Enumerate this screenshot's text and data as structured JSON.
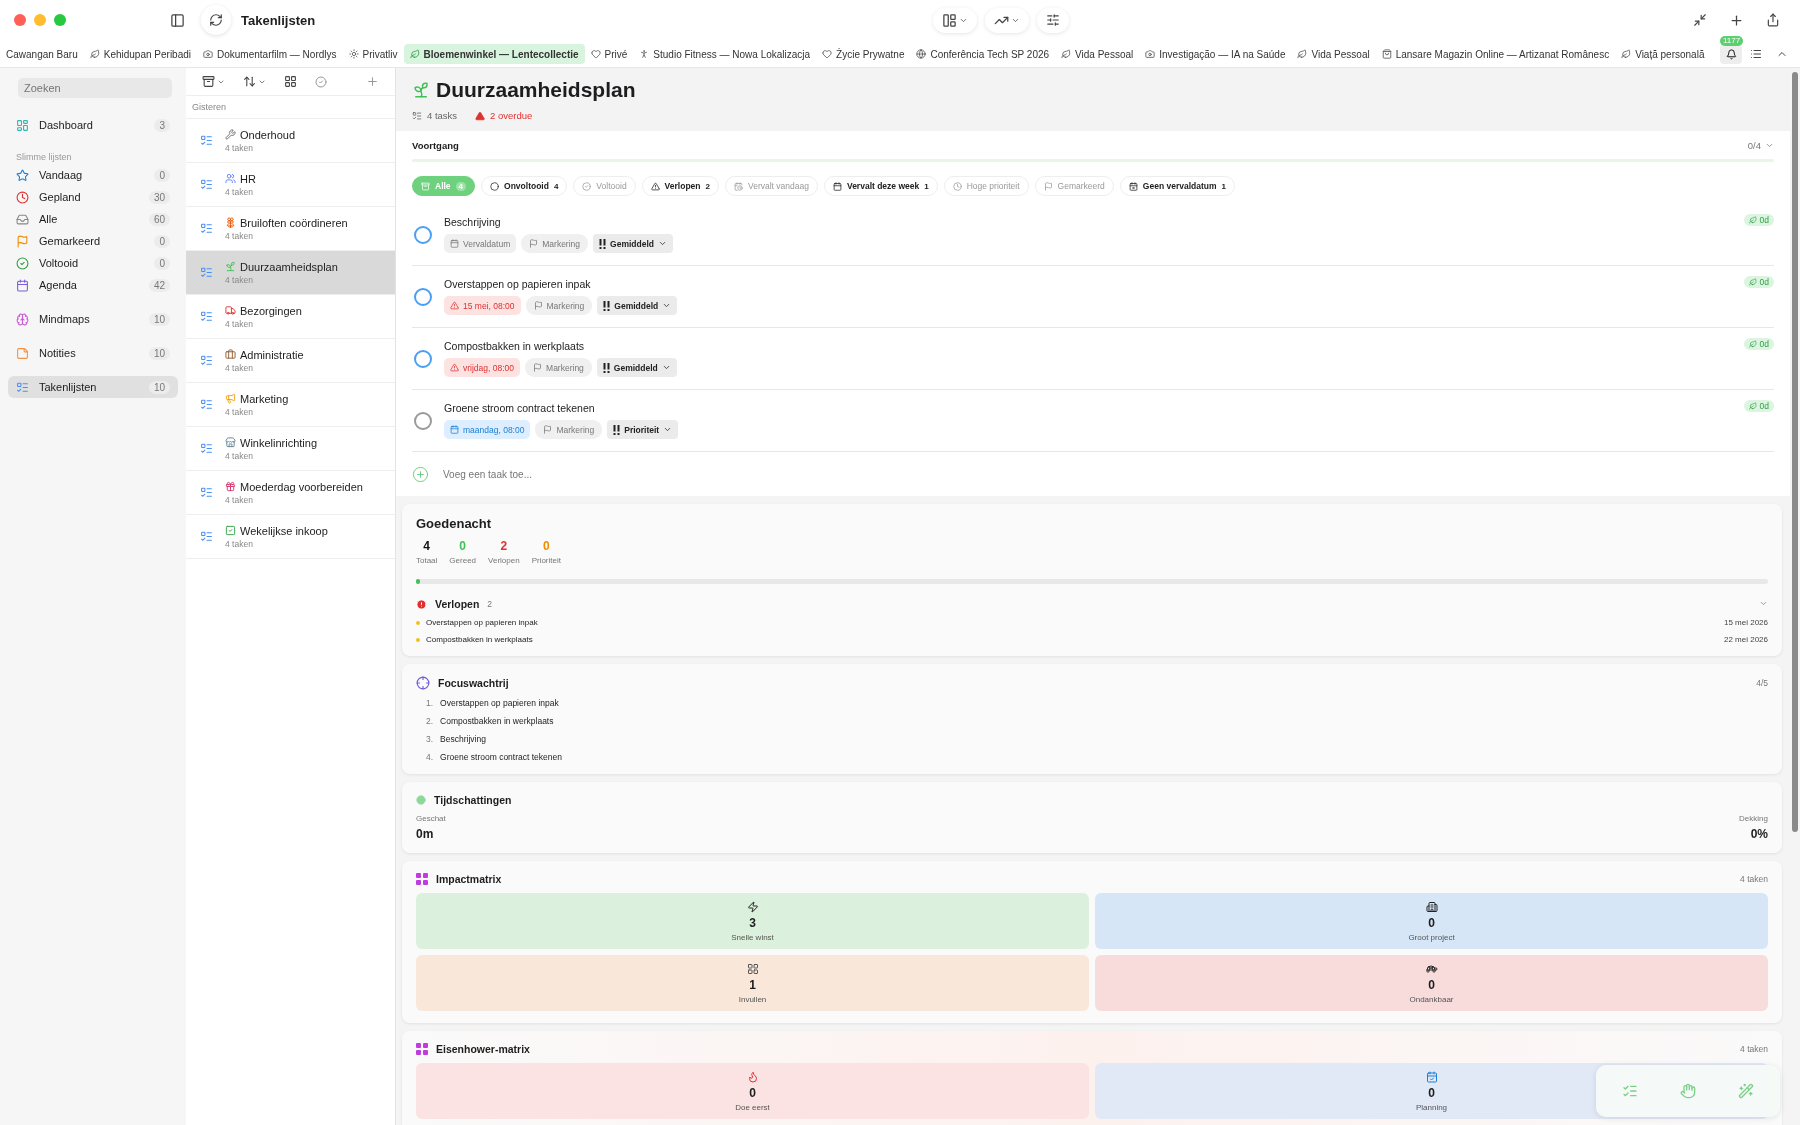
{
  "window": {
    "title": "Takenlijsten"
  },
  "tabs": [
    {
      "label": "Cawangan Baru",
      "selected": false
    },
    {
      "label": "Kehidupan Peribadi",
      "selected": false
    },
    {
      "label": "Dokumentarfilm — Nordlys",
      "selected": false
    },
    {
      "label": "Privatliv",
      "selected": false
    },
    {
      "label": "Bloemenwinkel — Lentecollectie",
      "selected": true
    },
    {
      "label": "Privé",
      "selected": false
    },
    {
      "label": "Studio Fitness — Nowa Lokalizacja",
      "selected": false
    },
    {
      "label": "Życie Prywatne",
      "selected": false
    },
    {
      "label": "Conferência Tech SP 2026",
      "selected": false
    },
    {
      "label": "Vida Pessoal",
      "selected": false
    },
    {
      "label": "Investigação — IA na Saúde",
      "selected": false
    },
    {
      "label": "Vida Pessoal",
      "selected": false
    },
    {
      "label": "Lansare Magazin Online — Artizanat Românesc",
      "selected": false
    },
    {
      "label": "Viață personală",
      "selected": false
    }
  ],
  "notifications": {
    "count": "1177"
  },
  "sidebar": {
    "search": {
      "placeholder": "Zoeken"
    },
    "groups": [
      {
        "items": [
          {
            "label": "Dashboard",
            "count": "3",
            "selected": false
          }
        ]
      },
      {
        "title": "Slimme lijsten",
        "items": [
          {
            "label": "Vandaag",
            "count": "0",
            "selected": false
          },
          {
            "label": "Gepland",
            "count": "30",
            "selected": false
          },
          {
            "label": "Alle",
            "count": "60",
            "selected": false
          },
          {
            "label": "Gemarkeerd",
            "count": "0",
            "selected": false
          },
          {
            "label": "Voltooid",
            "count": "0",
            "selected": false
          },
          {
            "label": "Agenda",
            "count": "42",
            "selected": false
          }
        ]
      },
      {
        "items": [
          {
            "label": "Mindmaps",
            "count": "10",
            "selected": false
          }
        ]
      },
      {
        "items": [
          {
            "label": "Notities",
            "count": "10",
            "selected": false
          }
        ]
      },
      {
        "items": [
          {
            "label": "Takenlijsten",
            "count": "10",
            "selected": true
          }
        ]
      }
    ]
  },
  "lists": {
    "section": "Gisteren",
    "items": [
      {
        "title": "Onderhoud",
        "subtitle": "4 taken",
        "selected": false
      },
      {
        "title": "HR",
        "subtitle": "4 taken",
        "selected": false
      },
      {
        "title": "Bruiloften coördineren",
        "subtitle": "4 taken",
        "selected": false
      },
      {
        "title": "Duurzaamheidsplan",
        "subtitle": "4 taken",
        "selected": true
      },
      {
        "title": "Bezorgingen",
        "subtitle": "4 taken",
        "selected": false
      },
      {
        "title": "Administratie",
        "subtitle": "4 taken",
        "selected": false
      },
      {
        "title": "Marketing",
        "subtitle": "4 taken",
        "selected": false
      },
      {
        "title": "Winkelinrichting",
        "subtitle": "4 taken",
        "selected": false
      },
      {
        "title": "Moederdag voorbereiden",
        "subtitle": "4 taken",
        "selected": false
      },
      {
        "title": "Wekelijkse inkoop",
        "subtitle": "4 taken",
        "selected": false
      }
    ]
  },
  "header": {
    "title": "Duurzaamheidsplan",
    "tasks": "4 tasks",
    "overdue": "2 overdue"
  },
  "progress": {
    "label": "Voortgang",
    "reading": "0/4",
    "level": 0
  },
  "filters": [
    {
      "label": "Alle",
      "count": "4",
      "selected": true,
      "disabled": false
    },
    {
      "label": "Onvoltooid",
      "count": "4",
      "selected": false,
      "disabled": false
    },
    {
      "label": "Voltooid",
      "selected": false,
      "disabled": true
    },
    {
      "label": "Verlopen",
      "count": "2",
      "selected": false,
      "disabled": false
    },
    {
      "label": "Vervalt vandaag",
      "selected": false,
      "disabled": true
    },
    {
      "label": "Vervalt deze week",
      "count": "1",
      "selected": false,
      "disabled": false
    },
    {
      "label": "Hoge prioriteit",
      "selected": false,
      "disabled": true
    },
    {
      "label": "Gemarkeerd",
      "selected": false,
      "disabled": true
    },
    {
      "label": "Geen vervaldatum",
      "count": "1",
      "selected": false,
      "disabled": false
    }
  ],
  "tasks": [
    {
      "title": "Beschrijving",
      "color": "#4a9ff5",
      "due": {
        "kind": "empty",
        "text": "Vervaldatum"
      },
      "flag": "Markering",
      "priority": "Gemiddeld",
      "age": "0d"
    },
    {
      "title": "Overstappen op papieren inpak",
      "color": "#4a9ff5",
      "due": {
        "kind": "overdue",
        "text": "15 mei, 08:00"
      },
      "flag": "Markering",
      "priority": "Gemiddeld",
      "age": "0d"
    },
    {
      "title": "Compostbakken in werkplaats",
      "color": "#4a9ff5",
      "due": {
        "kind": "overdue",
        "text": "vrijdag, 08:00"
      },
      "flag": "Markering",
      "priority": "Gemiddeld",
      "age": "0d"
    },
    {
      "title": "Groene stroom contract tekenen",
      "color": "#9a9a9a",
      "due": {
        "kind": "scheduled",
        "text": "maandag, 08:00"
      },
      "flag": "Markering",
      "priority": "Prioriteit",
      "age": "0d"
    }
  ],
  "add_task": {
    "placeholder": "Voeg een taak toe..."
  },
  "summary": {
    "title": "Goedenacht",
    "stats": [
      {
        "value": "4",
        "label": "Totaal",
        "kind": "total"
      },
      {
        "value": "0",
        "label": "Gereed",
        "kind": "done"
      },
      {
        "value": "2",
        "label": "Verlopen",
        "kind": "overdue"
      },
      {
        "value": "0",
        "label": "Prioriteit",
        "kind": "priority"
      }
    ],
    "level": 0,
    "overdue": {
      "title": "Verlopen",
      "count": "2",
      "items": [
        {
          "title": "Overstappen op papieren inpak",
          "date": "15 mei 2026"
        },
        {
          "title": "Compostbakken in werkplaats",
          "date": "22 mei 2026"
        }
      ]
    }
  },
  "focus": {
    "title": "Focuswachtrij",
    "reading": "4/5",
    "items": [
      {
        "number": "1.",
        "title": "Overstappen op papieren inpak"
      },
      {
        "number": "2.",
        "title": "Compostbakken in werkplaats"
      },
      {
        "number": "3.",
        "title": "Beschrijving"
      },
      {
        "number": "4.",
        "title": "Groene stroom contract tekenen"
      }
    ]
  },
  "estimates": {
    "title": "Tijdschattingen",
    "estimated_label": "Geschat",
    "estimated": "0m",
    "coverage_label": "Dekking",
    "coverage": "0%"
  },
  "matrices": [
    {
      "title": "Impactmatrix",
      "count": "4 taken",
      "cells": [
        {
          "value": "3",
          "label": "Snelle winst",
          "color": "#dcf1dd"
        },
        {
          "value": "0",
          "label": "Groot project",
          "color": "#d6e6f7"
        },
        {
          "value": "1",
          "label": "Invullen",
          "color": "#f9e8d9"
        },
        {
          "value": "0",
          "label": "Ondankbaar",
          "color": "#f8dcdc"
        }
      ]
    },
    {
      "title": "Eisenhower-matrix",
      "count": "4 taken",
      "cells": [
        {
          "value": "0",
          "label": "Doe eerst",
          "color": "#fbe3e3"
        },
        {
          "value": "0",
          "label": "Planning",
          "color": "#e2e9f6"
        }
      ]
    }
  ]
}
